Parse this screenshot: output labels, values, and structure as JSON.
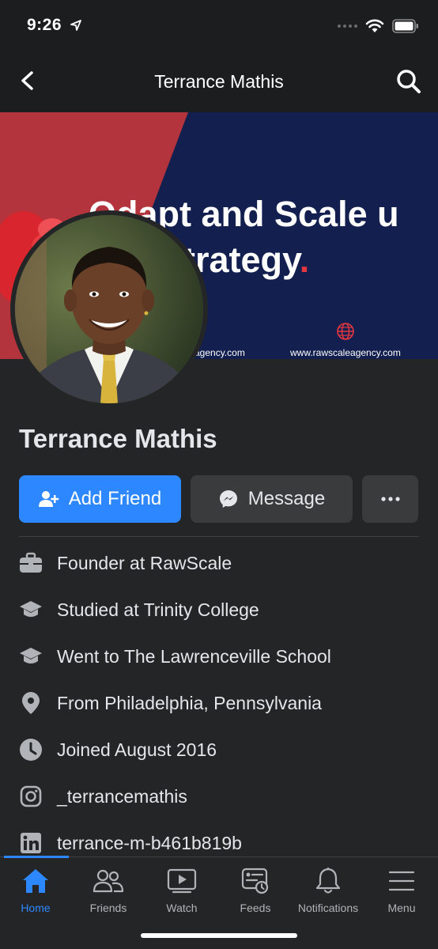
{
  "status_bar": {
    "time": "9:26"
  },
  "nav": {
    "title": "Terrance Mathis"
  },
  "cover": {
    "headline_line1": "Odapt and Scale u",
    "headline_line2": "u Strategy",
    "headline_dot": ".",
    "url_left": "agency.com",
    "url_right": "www.rawscaleagency.com"
  },
  "profile": {
    "name": "Terrance Mathis"
  },
  "actions": {
    "add_friend": "Add Friend",
    "message": "Message"
  },
  "intro": [
    {
      "icon": "briefcase-icon",
      "prefix": "Founder at ",
      "value": "RawScale"
    },
    {
      "icon": "graduation-cap-icon",
      "prefix": "Studied at ",
      "value": "Trinity College"
    },
    {
      "icon": "graduation-cap-icon",
      "prefix": "Went to ",
      "value": "The Lawrenceville School"
    },
    {
      "icon": "location-pin-icon",
      "prefix": "From ",
      "value": "Philadelphia, Pennsylvania"
    },
    {
      "icon": "clock-icon",
      "prefix": "Joined August 2016",
      "value": ""
    },
    {
      "icon": "instagram-icon",
      "prefix": "_terrancemathis",
      "value": ""
    },
    {
      "icon": "linkedin-icon",
      "prefix": "terrance-m-b461b819b",
      "value": ""
    }
  ],
  "tabs": [
    {
      "label": "Home",
      "icon": "home-icon",
      "active": true
    },
    {
      "label": "Friends",
      "icon": "friends-icon"
    },
    {
      "label": "Watch",
      "icon": "watch-icon"
    },
    {
      "label": "Feeds",
      "icon": "feeds-icon"
    },
    {
      "label": "Notifications",
      "icon": "bell-icon"
    },
    {
      "label": "Menu",
      "icon": "hamburger-icon"
    }
  ],
  "colors": {
    "accent": "#2d88ff",
    "background": "#242526",
    "button_secondary": "#3a3b3c"
  }
}
